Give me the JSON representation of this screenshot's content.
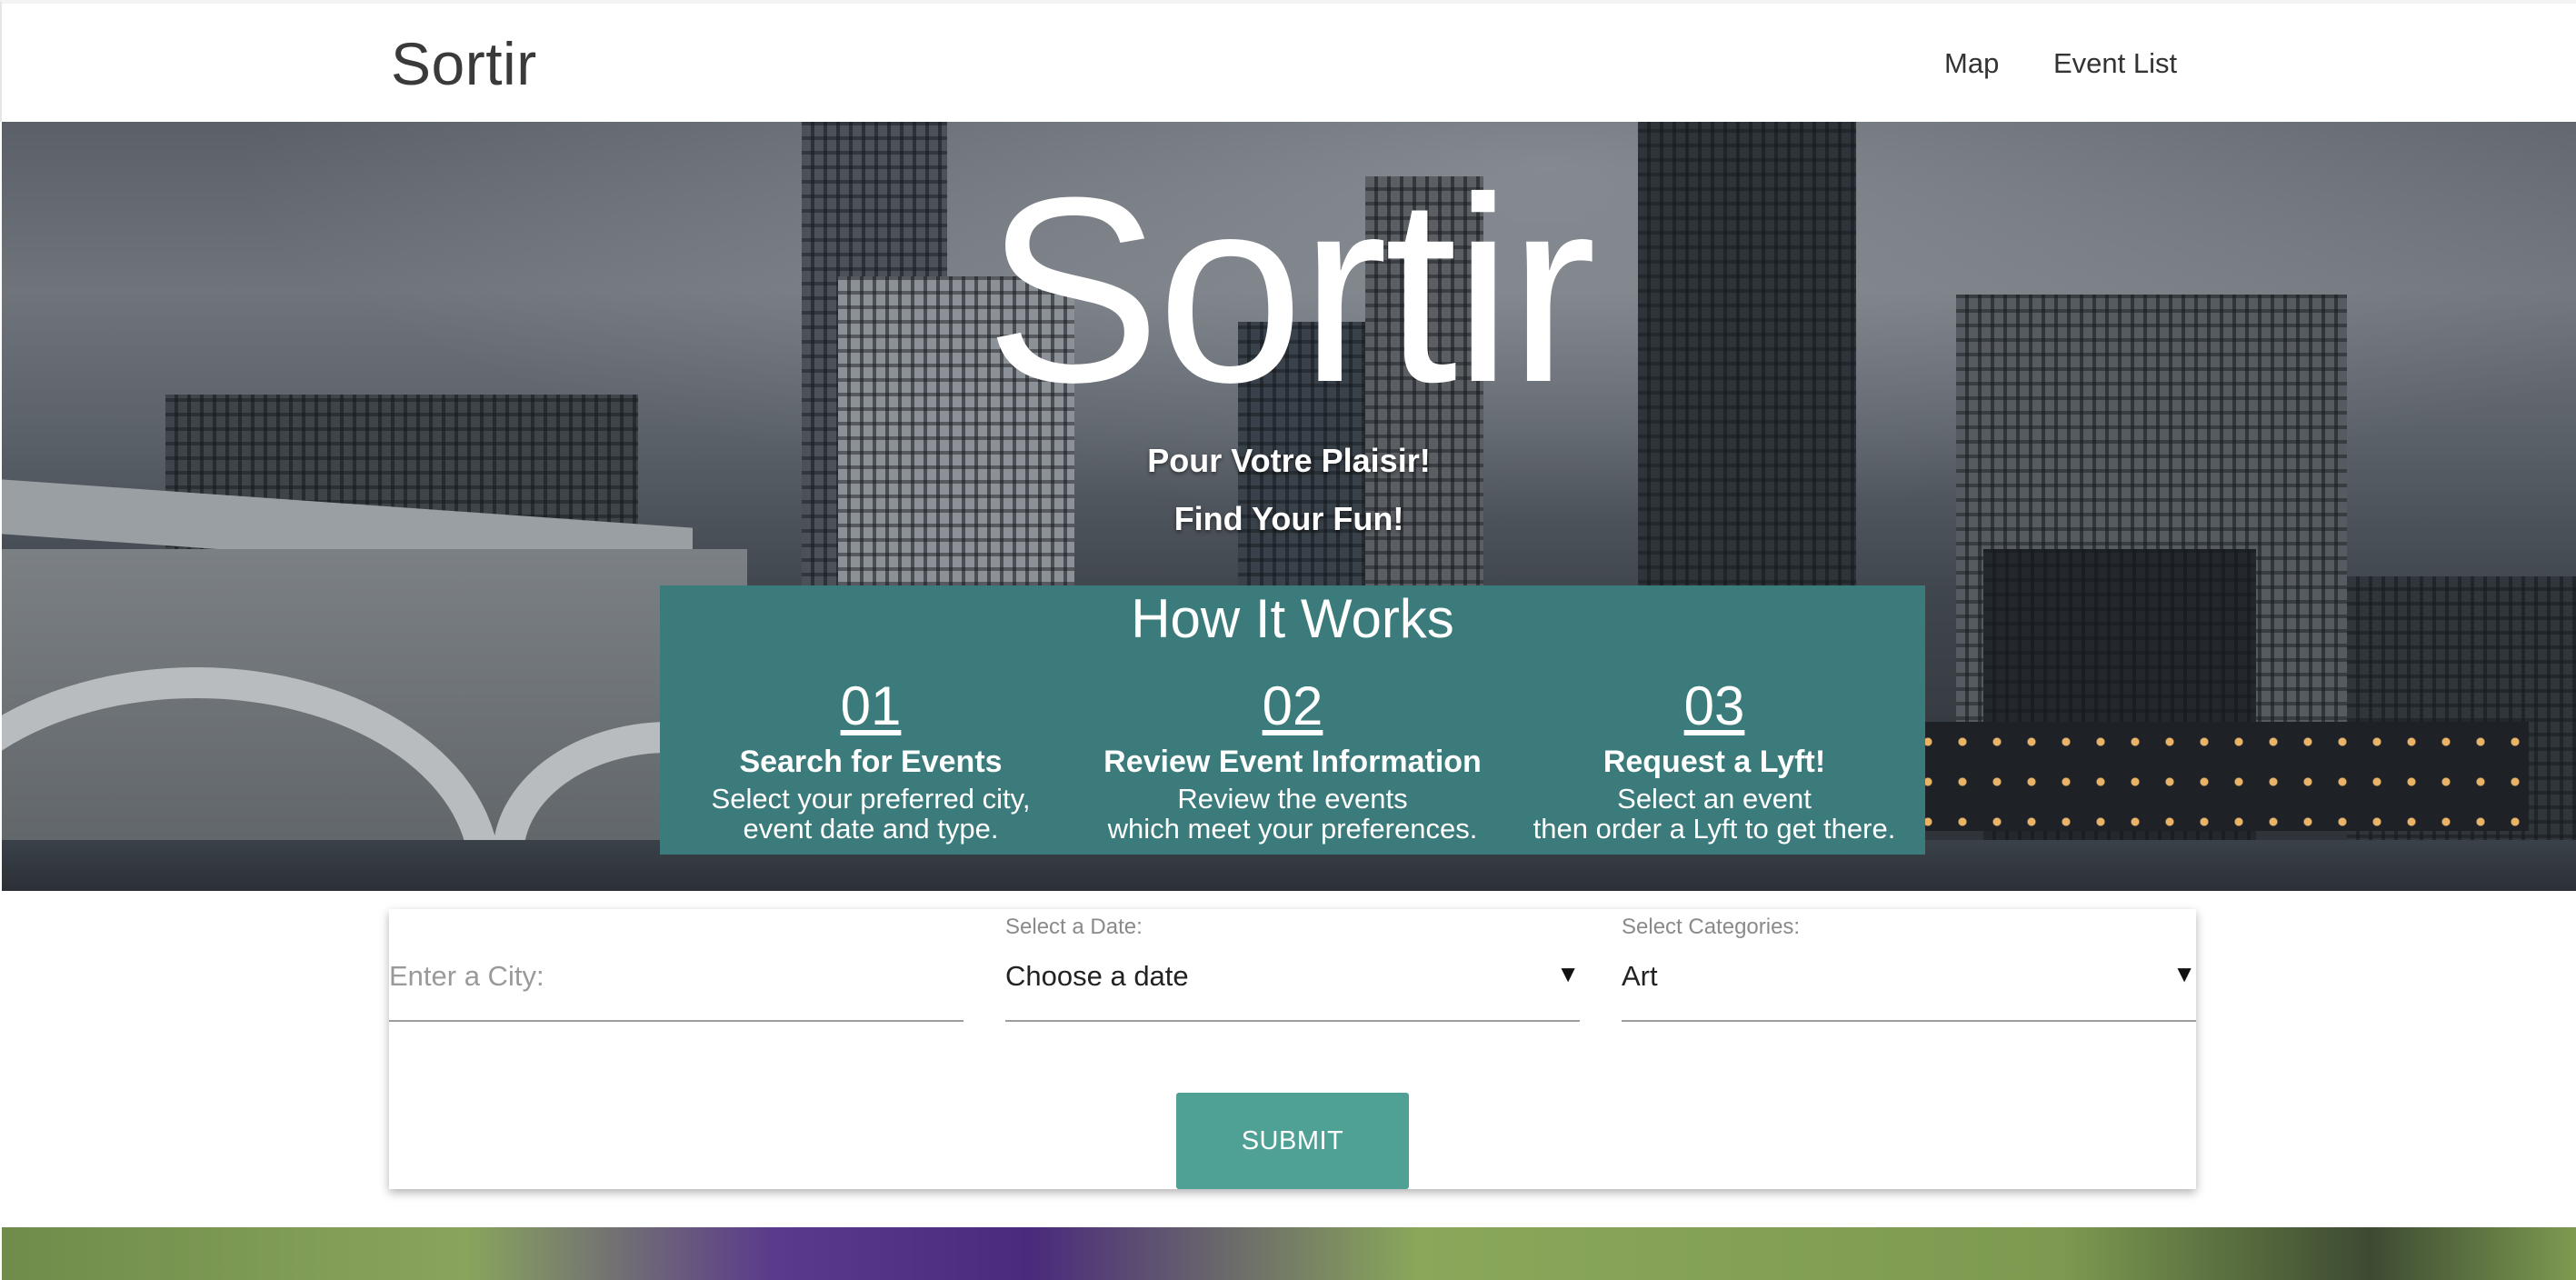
{
  "navbar": {
    "brand": "Sortir",
    "links": [
      "Map",
      "Event List"
    ]
  },
  "hero": {
    "title": "Sortir",
    "subtitle1": "Pour Votre Plaisir!",
    "subtitle2": "Find Your Fun!"
  },
  "how_it_works": {
    "title": "How It Works",
    "steps": [
      {
        "number": "01",
        "title": "Search for Events",
        "desc": "Select your preferred city,\nevent date and type."
      },
      {
        "number": "02",
        "title": "Review Event Information",
        "desc": "Review the events\nwhich meet your preferences."
      },
      {
        "number": "03",
        "title": "Request a Lyft!",
        "desc": "Select an event\nthen order a Lyft to get there."
      }
    ]
  },
  "form": {
    "city_placeholder": "Enter a City:",
    "date_label": "Select a Date:",
    "date_value": "Choose a date",
    "category_label": "Select Categories:",
    "category_value": "Art",
    "submit_label": "SUBMIT"
  },
  "colors": {
    "teal_box": "#3b7b7b",
    "submit_button": "#4fa095"
  }
}
